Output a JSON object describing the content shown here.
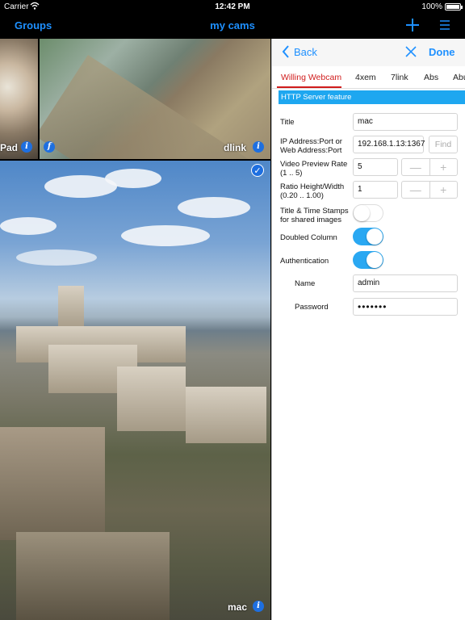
{
  "status_bar": {
    "carrier": "Carrier",
    "time": "12:42 PM",
    "battery": "100%",
    "battery_level": 1.0
  },
  "nav": {
    "groups": "Groups",
    "title": "my cams"
  },
  "cameras": [
    {
      "label": "Pad"
    },
    {
      "label": "dlink"
    },
    {
      "label": "mac"
    }
  ],
  "panel": {
    "back": "Back",
    "done": "Done",
    "tabs": [
      "Willing Webcam",
      "4xem",
      "7link",
      "Abs",
      "Abu"
    ],
    "section": "HTTP Server feature",
    "title_label": "Title",
    "title_value": "mac",
    "address_label_1": "IP Address:Port or",
    "address_label_2": "Web Address:Port",
    "address_value": "192.168.1.13:1367",
    "find": "Find",
    "rate_label_1": "Video Preview Rate",
    "rate_label_2": "(1 .. 5)",
    "rate_value": "5",
    "ratio_label_1": "Ratio Height/Width",
    "ratio_label_2": "(0.20 .. 1.00)",
    "ratio_value": "1",
    "stepper_minus": "—",
    "stepper_plus": "+",
    "stamps_label_1": "Title & Time Stamps",
    "stamps_label_2": "for shared images",
    "stamps_on": false,
    "doubled_label": "Doubled Column",
    "doubled_on": true,
    "auth_label": "Authentication",
    "auth_on": true,
    "name_label": "Name",
    "name_value": "admin",
    "password_label": "Password",
    "password_value": "•••••••"
  },
  "colors": {
    "accent": "#1e90ff",
    "active_tab": "#d01c1c",
    "toggle_on": "#2aa8f2",
    "banner": "#1ea7f0"
  }
}
